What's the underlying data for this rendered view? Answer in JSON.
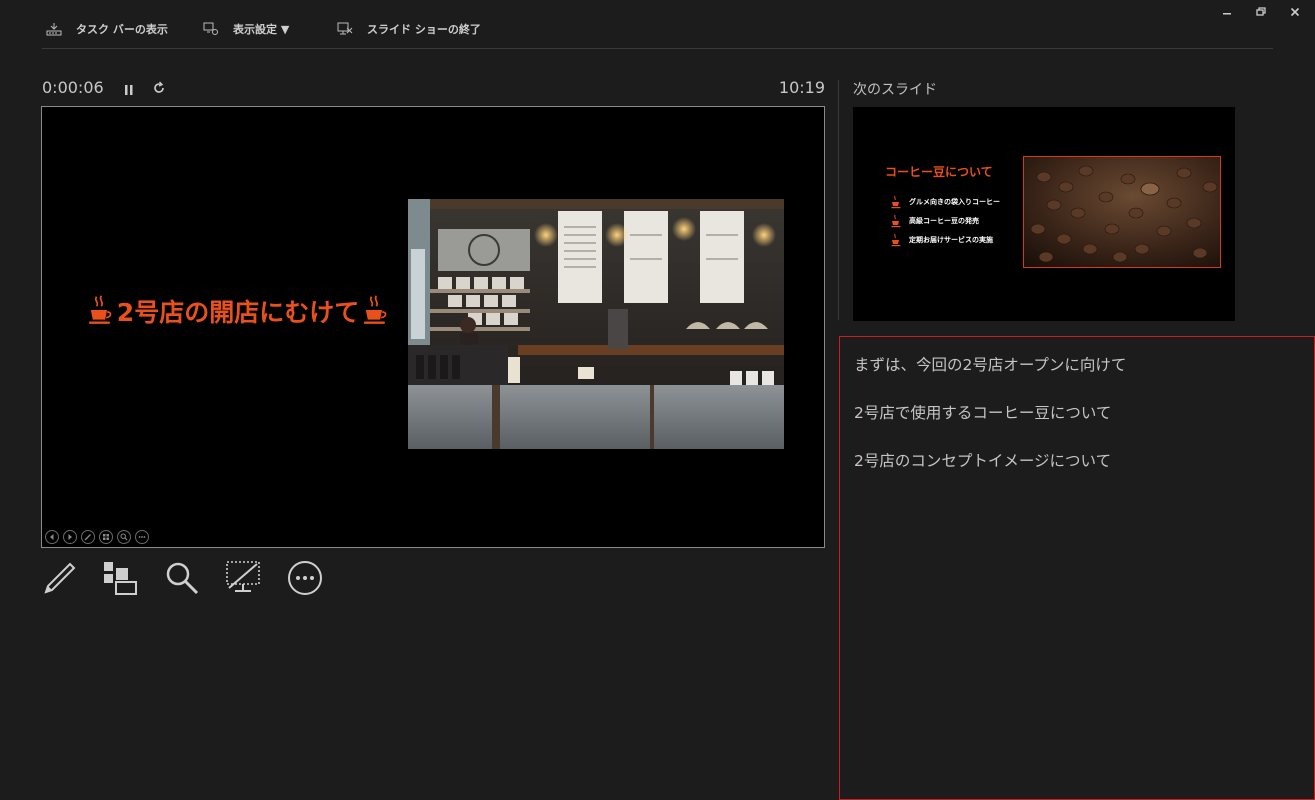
{
  "toolbar": {
    "taskbar_label": "タスク バーの表示",
    "display_settings_label": "表示設定 ▼",
    "end_show_label": "スライド ショーの終了"
  },
  "presenter": {
    "elapsed_time": "0:00:06",
    "clock": "10:19"
  },
  "current_slide": {
    "title": "2号店の開店にむけて"
  },
  "next_slide": {
    "label": "次のスライド",
    "title": "コーヒー豆について",
    "bullets": [
      "グルメ向きの袋入りコーヒー",
      "高級コーヒー豆の発売",
      "定期お届けサービスの実施"
    ]
  },
  "notes": {
    "lines": [
      "まずは、今回の2号店オープンに向けて",
      "2号店で使用するコーヒー豆について",
      "2号店のコンセプトイメージについて"
    ]
  },
  "colors": {
    "accent": "#e8501c",
    "notes_border": "#c81e1e",
    "background": "#1c1c1c"
  }
}
